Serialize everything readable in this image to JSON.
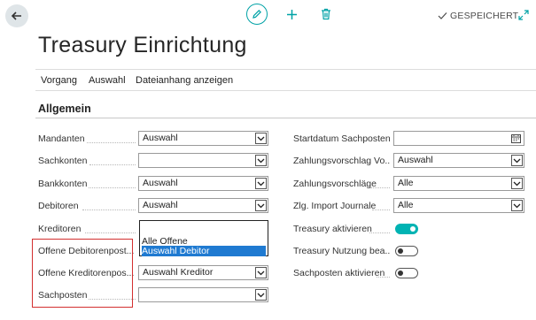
{
  "page": {
    "title": "Treasury Einrichtung"
  },
  "toolbar": {
    "saved_label": "GESPEICHERT"
  },
  "menu": [
    {
      "label": "Vorgang"
    },
    {
      "label": "Auswahl"
    },
    {
      "label": "Dateianhang anzeigen"
    }
  ],
  "section": {
    "title": "Allgemein"
  },
  "left_fields": [
    {
      "label": "Mandanten",
      "value": "Auswahl"
    },
    {
      "label": "Sachkonten",
      "value": ""
    },
    {
      "label": "Bankkonten",
      "value": "Auswahl"
    },
    {
      "label": "Debitoren",
      "value": "Auswahl"
    },
    {
      "label": "Kreditoren",
      "value": ""
    },
    {
      "label": "Offene Debitorenpost...",
      "value": ""
    },
    {
      "label": "Offene Kreditorenpos...",
      "value": "Auswahl Kreditor"
    },
    {
      "label": "Sachposten",
      "value": ""
    }
  ],
  "dropdown_options": [
    {
      "label": "Alle Offene"
    },
    {
      "label": "Auswahl Debitor"
    }
  ],
  "right_fields": [
    {
      "label": "Startdatum Sachposten",
      "value": ""
    },
    {
      "label": "Zahlungsvorschlag Vo...",
      "value": "Auswahl"
    },
    {
      "label": "Zahlungsvorschläge",
      "value": "Alle"
    },
    {
      "label": "Zlg. Import Journale",
      "value": "Alle"
    },
    {
      "label": "Treasury aktivieren"
    },
    {
      "label": "Treasury Nutzung bea..."
    },
    {
      "label": "Sachposten aktivieren"
    }
  ],
  "colors": {
    "accent": "#00b3b3",
    "highlight": "#1f7ad1",
    "annotation": "#d32f2f"
  }
}
